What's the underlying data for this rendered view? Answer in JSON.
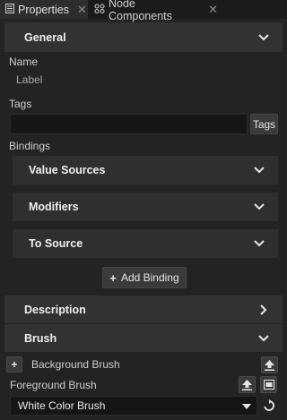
{
  "tabs": [
    {
      "label": "Properties",
      "active": true
    },
    {
      "label": "Node Components",
      "active": false
    }
  ],
  "sections": {
    "general": "General",
    "description": "Description",
    "brush": "Brush"
  },
  "name": {
    "label": "Name",
    "value": "Label"
  },
  "tags": {
    "label": "Tags",
    "value": "",
    "button": "Tags"
  },
  "bindings": {
    "label": "Bindings",
    "groups": [
      "Value Sources",
      "Modifiers",
      "To Source"
    ],
    "add_button": "Add Binding"
  },
  "brush": {
    "background_label": "Background Brush",
    "foreground_label": "Foreground Brush",
    "foreground_value": "White Color Brush"
  },
  "colors": {
    "background": "#232323",
    "section": "#323232",
    "input": "#151515"
  }
}
